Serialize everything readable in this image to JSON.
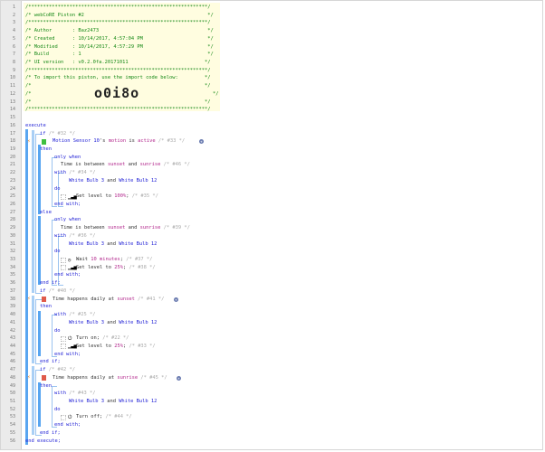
{
  "header": {
    "stars": "/*************************************************************/",
    "title": "/* webCoRE Piston #2                                          */",
    "author_line": "/* Author       : Baz2473                                     */",
    "created_line": "/* Created      : 10/14/2017, 4:57:04 PM                      */",
    "modified_line": "/* Modified     : 10/14/2017, 4:57:29 PM                      */",
    "build_line": "/* Build        : 1                                           */",
    "ui_line": "/* UI version   : v0.2.0fa.20171011                          */",
    "import_line": "/* To import this piston, use the import code below:         */",
    "blank_line_a": "/*                                                           */",
    "code_line_prefix": "/*",
    "code_line_suffix": "*/",
    "blank_line_b": "/*                                                           */",
    "import_code": "o0i8o"
  },
  "line_numbers": [
    "1",
    "2",
    "3",
    "4",
    "5",
    "6",
    "7",
    "8",
    "9",
    "10",
    "11",
    "12",
    "13",
    "14",
    "15",
    "16",
    "17",
    "18",
    "19",
    "20",
    "21",
    "22",
    "23",
    "24",
    "25",
    "26",
    "27",
    "28",
    "29",
    "30",
    "31",
    "32",
    "33",
    "34",
    "35",
    "36",
    "37",
    "38",
    "39",
    "40",
    "41",
    "42",
    "43",
    "44",
    "45",
    "46",
    "47",
    "48",
    "49",
    "50",
    "51",
    "52",
    "53",
    "54",
    "55",
    "56"
  ],
  "code": {
    "execute": "execute",
    "end_execute": "end execute;",
    "if1": {
      "kw": "if",
      "id": "/* #32 */"
    },
    "cond1": {
      "device": "Motion Sensor 10",
      "attr_pre": "'s ",
      "attr": "motion",
      "op": " is ",
      "value": "active",
      "id": "/* #33 */"
    },
    "then": "then",
    "else": "else",
    "end_if": "end if;",
    "only_when": "only when",
    "time_between_pre": "Time is between ",
    "sunset": "sunset",
    "and": " and ",
    "sunrise": "sunrise",
    "cond_a_id": "/* #46 */",
    "cond_b_id": "/* #39 */",
    "with": "with",
    "with_a_id": "/* #34 */",
    "with_b_id": "/* #36 */",
    "devices_pre": "White Bulb 3",
    "devices_and": " and ",
    "devices_post": "White Bulb 12",
    "do": "do",
    "set_level_100": "Set level to ",
    "val_100": "100%",
    "id_35": "/* #35 */",
    "end_with": "end with;",
    "wait_pre": "Wait ",
    "wait_val": "10 minutes",
    "id_37": "/* #37 */",
    "val_25": "25%",
    "id_38": "/* #38 */",
    "if2": {
      "kw": "if",
      "id": "/* #40 */"
    },
    "cond2": {
      "text": "Time happens daily at ",
      "at": "sunset",
      "id": "/* #41 */"
    },
    "with2_id": "/* #25 */",
    "turn_on": "Turn on;",
    "id_22": "/* #22 */",
    "id_33b": "/* #33 */",
    "if3": {
      "kw": "if",
      "id": "/* #42 */"
    },
    "cond3": {
      "text": "Time happens daily at ",
      "at": "sunrise",
      "id": "/* #45 */"
    },
    "with3_id": "/* #43 */",
    "turn_off": "Turn off;",
    "id_44": "/* #44 */",
    "semicolon": ";"
  },
  "colors": {
    "comment": "#188a18",
    "keyword": "#2323d6",
    "value": "#b2268c",
    "bar": "#58a5f0",
    "condition_true": "#3fbf3f",
    "condition_false": "#e05a4a"
  },
  "icons": [
    "lightning-bolt-icon",
    "add-icon",
    "brightness-icon",
    "clock-icon",
    "power-icon"
  ]
}
